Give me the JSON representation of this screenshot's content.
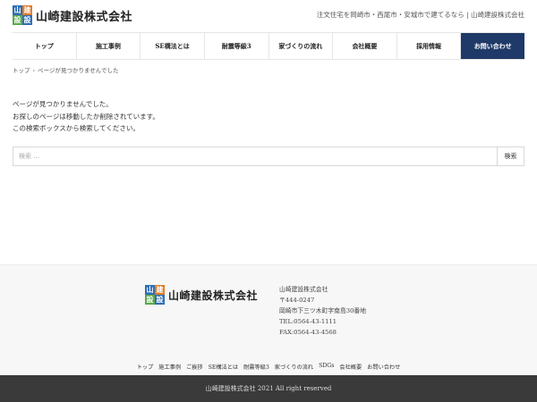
{
  "header": {
    "logo_mark": [
      "山",
      "建",
      "設",
      "設"
    ],
    "company_name": "山崎建設株式会社",
    "tagline": "注文住宅を岡崎市・西尾市・安城市で建てるなら | 山崎建設株式会社"
  },
  "nav": [
    {
      "label": "トップ"
    },
    {
      "label": "施工事例"
    },
    {
      "label": "SE構法とは"
    },
    {
      "label": "耐震等級3"
    },
    {
      "label": "家づくりの流れ"
    },
    {
      "label": "会社概要"
    },
    {
      "label": "採用情報"
    },
    {
      "label": "お問い合わせ"
    }
  ],
  "breadcrumb": {
    "home": "トップ",
    "separator": "›",
    "current": "ページが見つかりませんでした"
  },
  "message": {
    "line1": "ページが見つかりませんでした。",
    "line2": "お探しのページは移動したか削除されています。",
    "line3": "この検索ボックスから検索してください。"
  },
  "search": {
    "placeholder": "検索 …",
    "button_label": "検索"
  },
  "footer": {
    "company_name": "山崎建設株式会社",
    "info": {
      "name": "山崎建設株式会社",
      "postal": "〒444-0247",
      "address": "岡崎市下三ツ木町字南島30番地",
      "tel": "TEL:0564-43-1111",
      "fax": "FAX:0564-43-4568"
    },
    "links": [
      "トップ",
      "施工事例",
      "ご挨拶",
      "SE構法とは",
      "耐震等級3",
      "家づくりの流れ",
      "SDGs",
      "会社概要",
      "お問い合わせ"
    ]
  },
  "copyright": "山崎建設株式会社 2021 All right reserved",
  "colors": {
    "nav_active": "#1f3a68",
    "footer_bg": "#f7f7f7",
    "copyright_bg": "#3a3a3a"
  }
}
